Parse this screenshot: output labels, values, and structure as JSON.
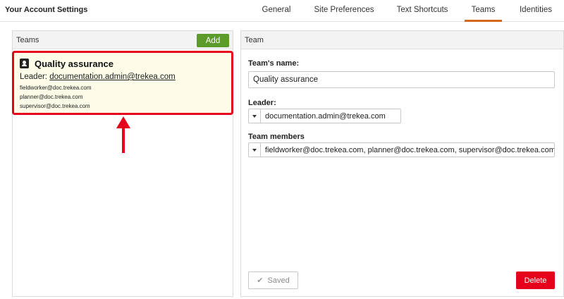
{
  "app": {
    "title": "Your Account Settings"
  },
  "tabs": [
    {
      "label": "General"
    },
    {
      "label": "Site Preferences"
    },
    {
      "label": "Text Shortcuts"
    },
    {
      "label": "Teams",
      "active": true
    },
    {
      "label": "Identities"
    }
  ],
  "left_panel": {
    "header": "Teams",
    "add_label": "Add"
  },
  "team": {
    "name": "Quality assurance",
    "leader_prefix": "Leader:",
    "leader": "documentation.admin@trekea.com",
    "members": [
      "fieldworker@doc.trekea.com",
      "planner@doc.trekea.com",
      "supervisor@doc.trekea.com"
    ],
    "icon": "contact-card-icon"
  },
  "right_panel": {
    "header": "Team",
    "name_label": "Team's name:",
    "name_value": "Quality assurance",
    "leader_label": "Leader:",
    "leader_value": "documentation.admin@trekea.com",
    "members_label": "Team members",
    "members_value": "fieldworker@doc.trekea.com, planner@doc.trekea.com, supervisor@doc.trekea.com",
    "saved_label": "Saved",
    "delete_label": "Delete"
  },
  "colors": {
    "accent_tab": "#d2691e",
    "add_button": "#5a9b29",
    "highlight": "#e5001c",
    "delete_button": "#e5001c"
  }
}
